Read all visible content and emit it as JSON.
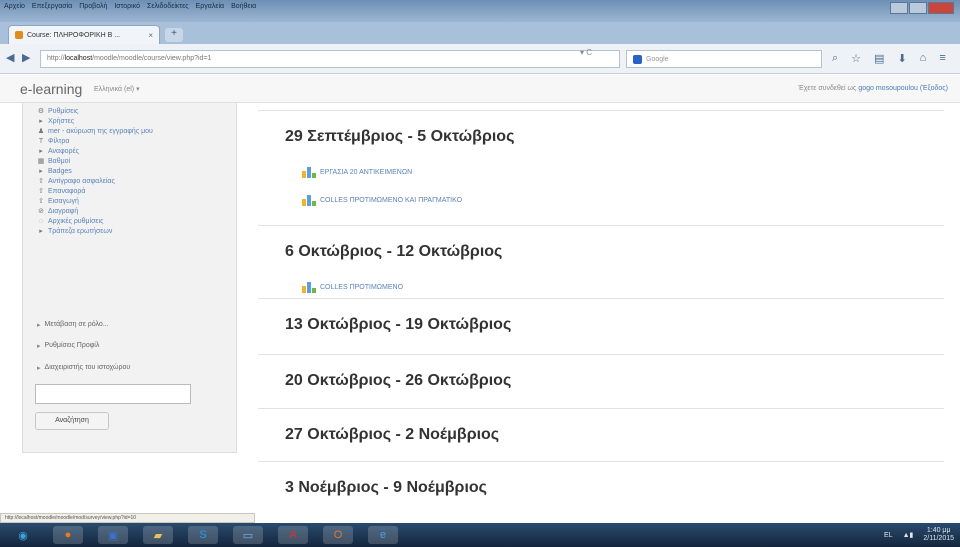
{
  "browser": {
    "menu": [
      "Αρχείο",
      "Επεξεργασία",
      "Προβολή",
      "Ιστορικό",
      "Σελιδοδείκτες",
      "Εργαλεία",
      "Βοήθεια"
    ],
    "tab_title": "Course: ΠΛΗΡΟΦΟΡΙΚΗ Β ...",
    "url_prefix": "http://",
    "url_host": "localhost",
    "url_path": "/moodle/moodle/course/view.php?id=1",
    "search_placeholder": "Google"
  },
  "moodle": {
    "brand": "e-learning",
    "language": "Ελληνικά (el) ▾",
    "login_text": "Έχετε συνδεθεί ως ",
    "user": "gogo mosoupoulou",
    "logout": "(Έξοδος)"
  },
  "sidebar": {
    "items": [
      {
        "icon": "settings-icon",
        "glyph": "⚙",
        "label": "Ρυθμίσεις"
      },
      {
        "icon": "arrow-right-icon",
        "glyph": "▸",
        "label": "Χρήστες"
      },
      {
        "icon": "user-icon",
        "glyph": "♟",
        "label": "mer - ακύρωση της εγγραφής μου"
      },
      {
        "icon": "filter-icon",
        "glyph": "T",
        "label": "Φίλτρα"
      },
      {
        "icon": "arrow-right-icon",
        "glyph": "▸",
        "label": "Αναφορές"
      },
      {
        "icon": "grades-icon",
        "glyph": "▦",
        "label": "Βαθμοί"
      },
      {
        "icon": "arrow-right-icon",
        "glyph": "▸",
        "label": "Badges"
      },
      {
        "icon": "backup-icon",
        "glyph": "⇧",
        "label": "Αντίγραφο ασφαλείας"
      },
      {
        "icon": "restore-icon",
        "glyph": "⇧",
        "label": "Επαναφορά"
      },
      {
        "icon": "import-icon",
        "glyph": "⇧",
        "label": "Εισαγωγή"
      },
      {
        "icon": "reset-icon",
        "glyph": "⊘",
        "label": "Διαγραφή"
      },
      {
        "icon": "reset-icon",
        "glyph": "◌",
        "label": "Αρχικές ρυθμίσεις"
      },
      {
        "icon": "arrow-right-icon",
        "glyph": "▸",
        "label": "Τράπεζα ερωτήσεων"
      }
    ],
    "sections": [
      "Μετάβαση σε ρόλο...",
      "Ρυθμίσεις Προφίλ",
      "Διαχειριστής του ιστοχώρου"
    ],
    "search_button": "Αναζήτηση"
  },
  "weeks": [
    {
      "title": "29 Σεπτέμβριος - 5 Οκτώβριος",
      "activities": [
        "ΕΡΓΑΣΙΑ 20 ΑΝΤΙΚΕΙΜΕΝΩΝ",
        "COLLES ΠΡΟΤΙΜΩΜΕΝΟ ΚΑΙ ΠΡΑΓΜΑΤΙΚΟ"
      ]
    },
    {
      "title": "6 Οκτώβριος - 12 Οκτώβριος",
      "activities": [
        "COLLES ΠΡΟΤΙΜΩΜΕΝΟ"
      ]
    },
    {
      "title": "13 Οκτώβριος - 19 Οκτώβριος",
      "activities": []
    },
    {
      "title": "20 Οκτώβριος - 26 Οκτώβριος",
      "activities": []
    },
    {
      "title": "27 Οκτώβριος - 2 Νοέμβριος",
      "activities": []
    },
    {
      "title": "3 Νοέμβριος - 9 Νοέμβριος",
      "activities": []
    }
  ],
  "status_url": "http://localhost/moodle/moodle/mod/survey/view.php?id=10",
  "taskbar": {
    "apps": [
      "start-orb-icon",
      "firefox-icon",
      "media-icon",
      "folder-icon",
      "skype-icon",
      "monitor-icon",
      "pdf-icon",
      "outlook-icon",
      "ie-icon"
    ],
    "time": "1:40 μμ",
    "date": "2/11/2015"
  }
}
